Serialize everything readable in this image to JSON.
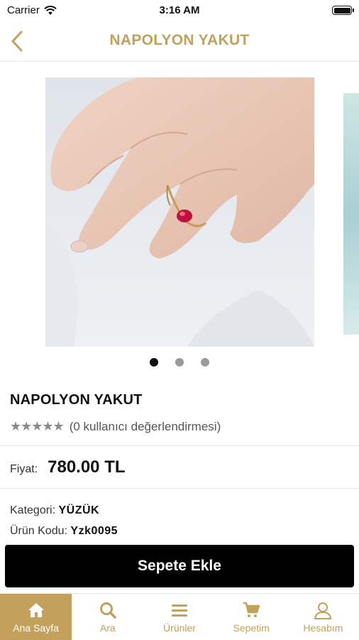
{
  "status": {
    "carrier": "Carrier",
    "time": "3:16 AM"
  },
  "nav": {
    "title": "NAPOLYON YAKUT",
    "back_icon": "chevron-left-icon"
  },
  "gallery": {
    "page_count": 3,
    "active_page": 1
  },
  "product": {
    "name": "NAPOLYON YAKUT",
    "stars": "★★★★★",
    "rating_text": "(0 kullanıcı değerlendirmesi)",
    "price_label": "Fiyat:",
    "price_value": "780.00 TL",
    "category_label": "Kategori:",
    "category_value": "YÜZÜK",
    "code_label": "Ürün Kodu:",
    "code_value": "Yzk0095"
  },
  "add_to_cart_label": "Sepete Ekle",
  "tabs": [
    {
      "label": "Ana Sayfa",
      "icon": "home-icon"
    },
    {
      "label": "Ara",
      "icon": "search-icon"
    },
    {
      "label": "Ürünler",
      "icon": "menu-icon"
    },
    {
      "label": "Sepetim",
      "icon": "cart-icon"
    },
    {
      "label": "Hesabım",
      "icon": "user-icon"
    }
  ],
  "colors": {
    "accent": "#c4a15a",
    "button": "#000000"
  }
}
